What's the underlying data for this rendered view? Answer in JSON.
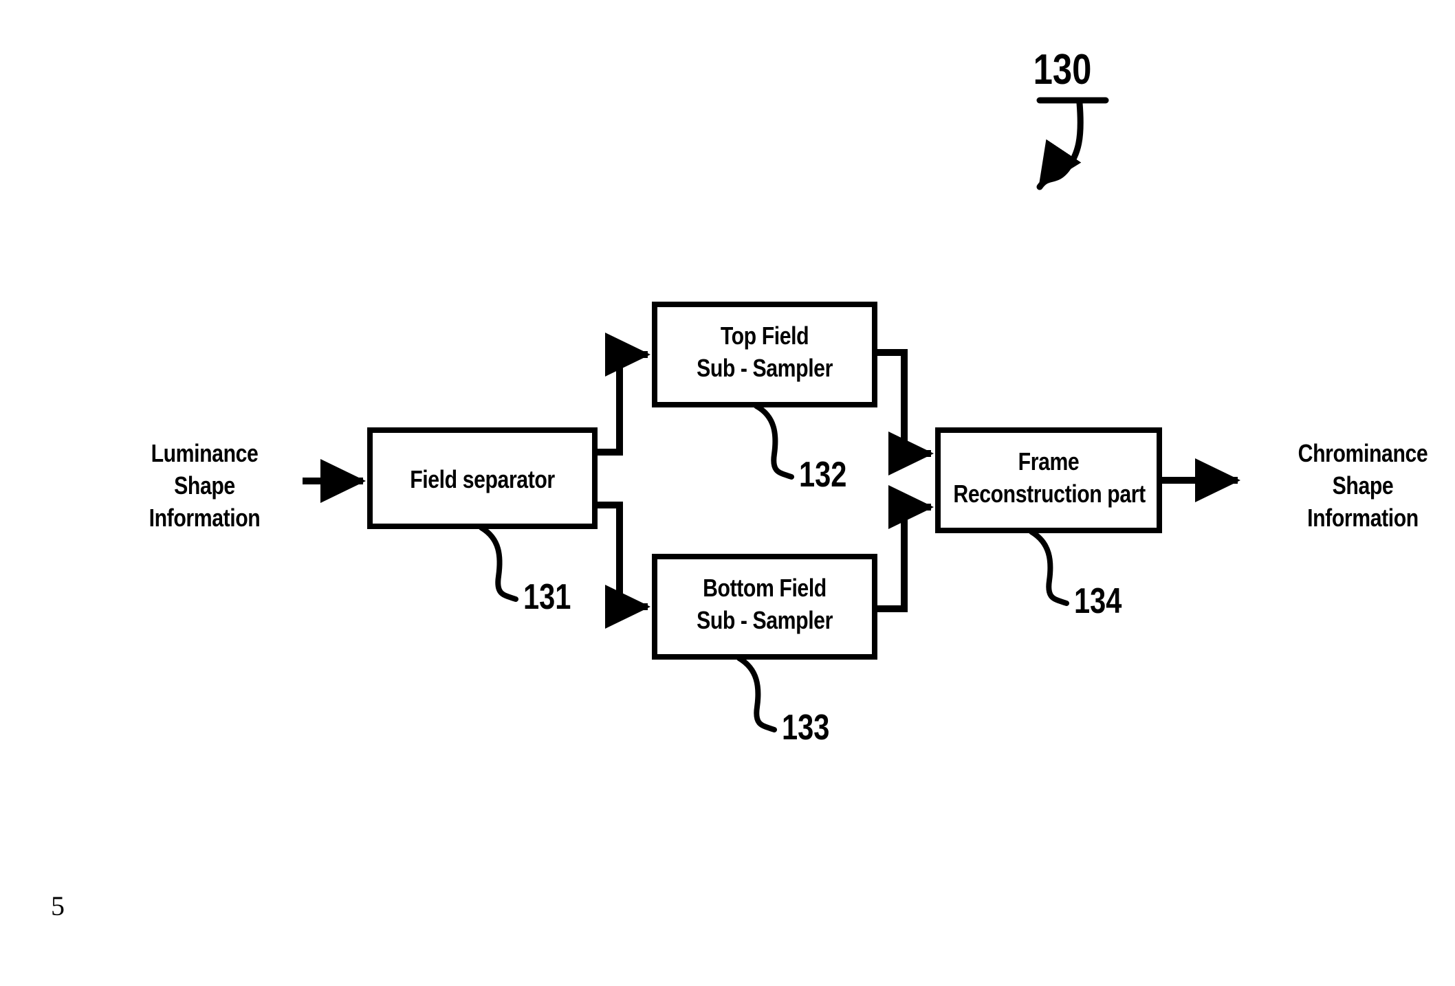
{
  "figure": {
    "number": "130",
    "page_marker": "5"
  },
  "io": {
    "input_label": "Luminance\nShape\nInformation",
    "input_lines": [
      "Luminance",
      "Shape",
      "Information"
    ],
    "output_label": "Chrominance\nShape\nInformation",
    "output_lines": [
      "Chrominance",
      "Shape",
      "Information"
    ]
  },
  "blocks": [
    {
      "id": "field-separator",
      "lines": [
        "Field separator"
      ],
      "ref": "131"
    },
    {
      "id": "top-field-sub-sampler",
      "lines": [
        "Top Field",
        "Sub - Sampler"
      ],
      "ref": "132"
    },
    {
      "id": "bottom-field-sub-sampler",
      "lines": [
        "Bottom Field",
        "Sub - Sampler"
      ],
      "ref": "133"
    },
    {
      "id": "frame-reconstruction-part",
      "lines": [
        "Frame",
        "Reconstruction part"
      ],
      "ref": "134"
    }
  ],
  "colors": {
    "stroke": "#000000",
    "background": "#ffffff"
  }
}
